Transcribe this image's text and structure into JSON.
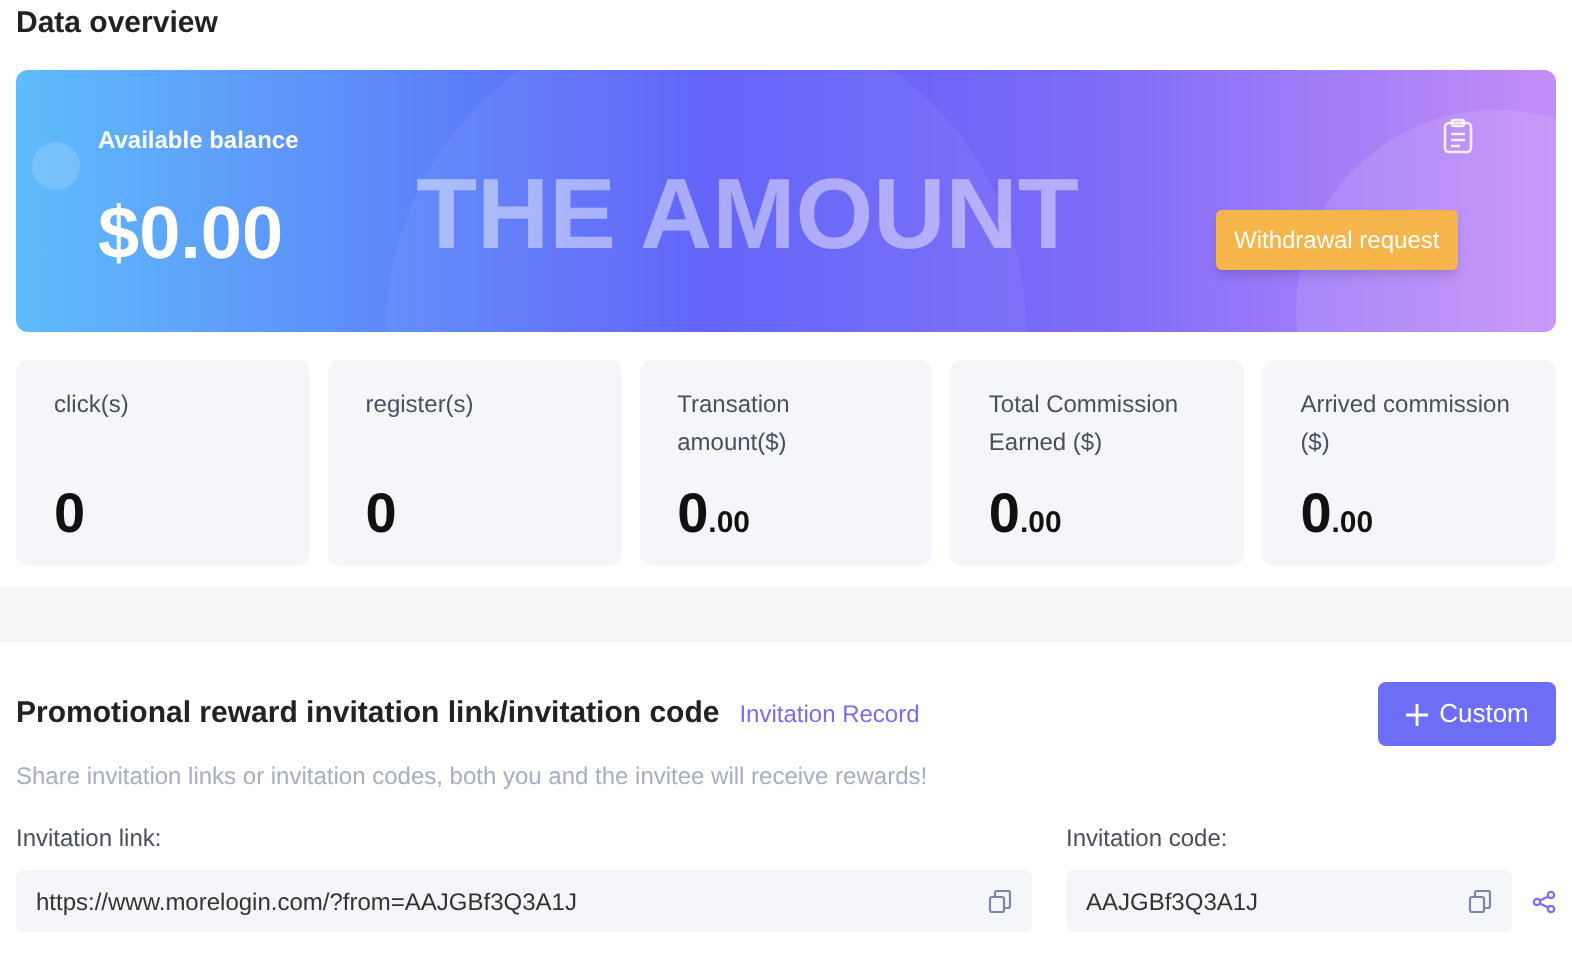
{
  "page_title": "Data overview",
  "balance": {
    "label": "Available balance",
    "amount": "$0.00",
    "backdrop_text": "THE AMOUNT",
    "button": "Withdrawal request"
  },
  "stats": [
    {
      "label": "click(s)",
      "value": "0"
    },
    {
      "label": "register(s)",
      "value": "0"
    },
    {
      "label": "Transation amount($)",
      "value": "0",
      "fraction": ".00"
    },
    {
      "label": "Total Commission Earned ($)",
      "value": "0",
      "fraction": ".00"
    },
    {
      "label": "Arrived commission ($)",
      "value": "0",
      "fraction": ".00"
    }
  ],
  "invitation": {
    "title": "Promotional reward invitation link/invitation code",
    "record_link": "Invitation Record",
    "custom_button": "Custom",
    "hint": "Share invitation links or invitation codes, both you and the invitee will receive rewards!",
    "link_label": "Invitation link:",
    "link_value": "https://www.morelogin.com/?from=AAJGBf3Q3A1J",
    "code_label": "Invitation code:",
    "code_value": "AAJGBf3Q3A1J"
  }
}
